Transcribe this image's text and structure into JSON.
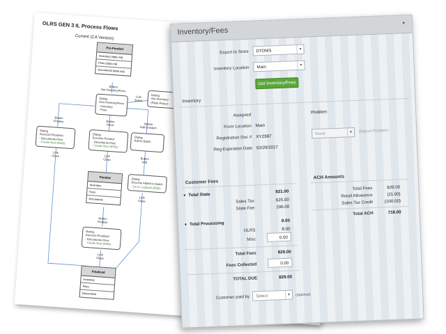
{
  "document": {
    "title": "OLRS GEN 3 IL Process Flows",
    "subtitle": "Current (CA Version)",
    "pre_pended": {
      "head": "Pre-Pended",
      "rows": [
        "Inventory (data n/a)",
        "Fees (data n/a)",
        "Documents (data n/a)"
      ]
    },
    "get_inv_label": "Button\nGet Inventory/Fees",
    "dialog_get_inv": "Dialog\nGet Inventory/Fees\n- Inventory\n- Fees",
    "link_select": "Link\nSelect",
    "dialog_plate": "Dialog\nGet Inventory\n(Plate Picker)",
    "btn_finalize": "Button\nFinalize",
    "btn_pend": "Button\nPend",
    "btn_add_batch": "Button\nAdd to Batch",
    "dialog_success_finalized": {
      "text": "Dialog\nSuccess Finalized\n- Documents Print",
      "link": "- Create New (END)"
    },
    "dialog_success_pended": {
      "text": "Dialog\nSuccess Pended\n- Documents Print",
      "link": "- Create New (END)"
    },
    "dialog_add_batch": "Dialog\nAdd to Batch",
    "link_close_1": "Link\nClose",
    "link_close_2": "Link\nClose",
    "btn_add": "Button\nAdd",
    "pended": {
      "head": "Pended",
      "rows": [
        "Inventory",
        "Fees",
        "Documents"
      ]
    },
    "dialog_success_added": {
      "text": "Dialog\nSuccess Added to Batch",
      "link": "- Go to Logbook (END)"
    },
    "link_close_3": "Link\nClose",
    "btn_finalize_2": "Button\nFinalize",
    "dialog_success_finalized_2": {
      "text": "Dialog\nSuccess Finalized\n- Documents Print",
      "link": "- Create New (END)"
    },
    "link_close_4": "Link\nClose",
    "finalized": {
      "head": "Finalized",
      "rows": [
        "Inventory",
        "Fees",
        "Documents"
      ]
    }
  },
  "panel": {
    "title": "Inventory/Fees",
    "export_label": "Export to Store",
    "export_value": "DTDMS",
    "location_label": "Inventory Location",
    "location_value": "Main",
    "get_button": "Get Inventory/Fees",
    "inventory_heading": "Inventory",
    "assigned_label": "Assigned",
    "from_location_label": "From Location",
    "from_location_value": "Main",
    "reg_doc_label": "Registration Doc #",
    "reg_doc_value": "XYZ987",
    "reg_exp_label": "Reg Expiration Date",
    "reg_exp_value": "02/29/2017",
    "problem_label": "Problem",
    "problem_select": "None",
    "report_problem": "Report Problem",
    "customer_fees_heading": "Customer Fees",
    "total_state_label": "Total State",
    "total_state_value": "821.00",
    "sales_tax_label": "Sales Tax",
    "sales_tax_value": "625.00",
    "state_fee_label": "State Fee",
    "state_fee_value": "196.00",
    "total_processing_label": "Total Processing",
    "total_processing_value": "8.00",
    "olrs_label": "OLRS",
    "olrs_value": "8.00",
    "misc_label": "Misc",
    "misc_value": "0.00",
    "total_fees_label": "Total Fees",
    "total_fees_value": "829.00",
    "fees_collected_label": "Fees Collected",
    "fees_collected_value": "0.00",
    "total_due_label": "TOTAL DUE",
    "total_due_value": "829.00",
    "customer_paid_label": "Customer paid by",
    "customer_paid_placeholder": "Select",
    "optional": "(optional)",
    "ach_heading": "ACH Amounts",
    "ach_total_fees_label": "Total Fees",
    "ach_total_fees_value": "829.00",
    "retail_allowance_label": "Retail Allowance",
    "retail_allowance_value": "(11.00)",
    "sales_tax_credit_label": "Sales Tax Credit",
    "sales_tax_credit_value": "(100.00)",
    "total_ach_label": "Total ACH",
    "total_ach_value": "718.00"
  }
}
